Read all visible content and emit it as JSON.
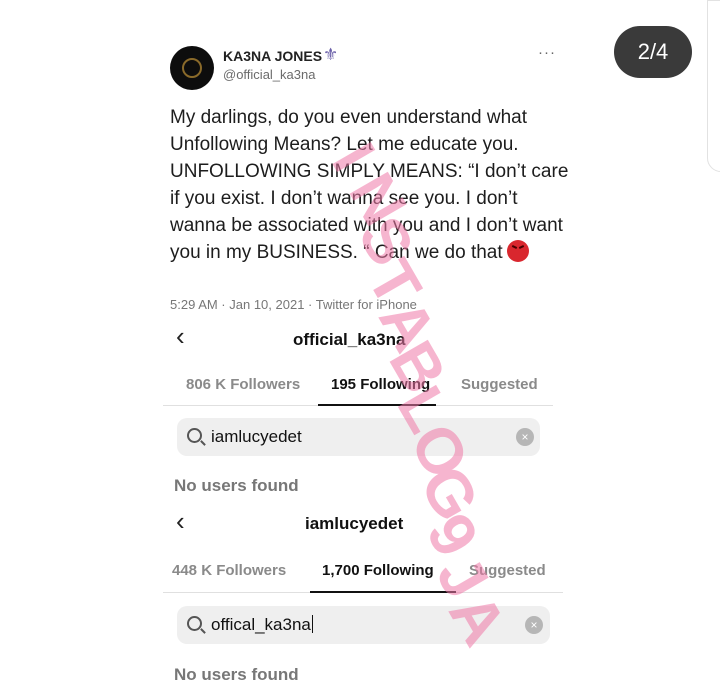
{
  "viewer": {
    "page_counter": "2/4"
  },
  "tweet": {
    "display_name": "KA3NA JONES",
    "badge_icon": "fleur-de-lis-icon",
    "handle": "@official_ka3na",
    "more": "···",
    "text": "My darlings, do you even understand what Unfollowing Means? Let me educate you. UNFOLLOWING SIMPLY MEANS: “I don’t care if you exist. I don’t wanna see you. I don’t wanna be associated with you and I don’t want you in my BUSINESS. “ Can we do that",
    "emoji": "angry-face-icon",
    "meta": "5:29 AM · Jan 10, 2021 · Twitter for iPhone"
  },
  "panel1": {
    "back": "‹",
    "username": "official_ka3na",
    "tabs": [
      "806 K Followers",
      "195 Following",
      "Suggested"
    ],
    "active_tab": 1,
    "search_query": "iamlucyedet",
    "clear": "×",
    "empty_message": "No users found"
  },
  "panel2": {
    "back": "‹",
    "username": "iamlucyedet",
    "tabs": [
      "448 K Followers",
      "1,700 Following",
      "Suggested"
    ],
    "active_tab": 1,
    "search_query": "offical_ka3na",
    "clear": "×",
    "empty_message": "No users found"
  },
  "watermark": {
    "text": "INSTABLOG9JA",
    "color": "#f07aa8"
  }
}
